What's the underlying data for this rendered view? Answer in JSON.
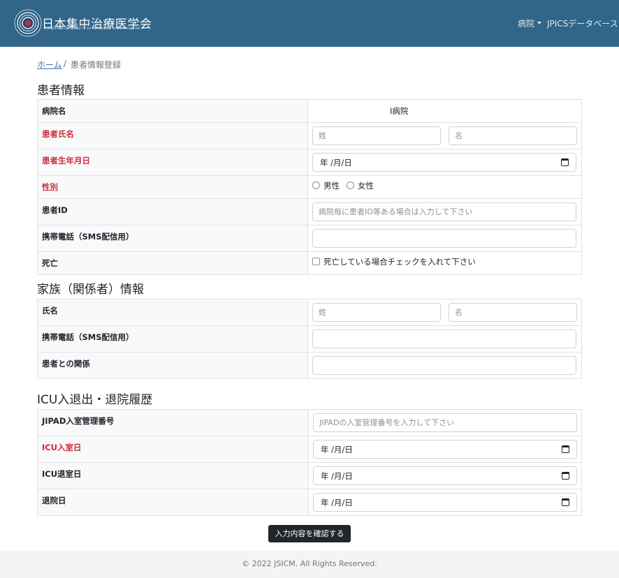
{
  "header": {
    "brand_jp": "日本集中治療医学会",
    "brand_en": "THE JAPANESE SOCIETY OF INTENSIVE CARE MEDICINE",
    "nav_hospital": "病院",
    "nav_db": "JPICSデータベース",
    "brand_color": "#31658a"
  },
  "breadcrumb": {
    "home": "ホーム",
    "separator": "/",
    "current": "患者情報登録"
  },
  "patient": {
    "title": "患者情報",
    "hospital_label": "病院名",
    "hospital_value": "I病院",
    "name_label": "患者氏名",
    "name_last_placeholder": "姓",
    "name_first_placeholder": "名",
    "dob_label": "患者生年月日",
    "dob_value": "年 /月/日",
    "sex_label": "性別",
    "sex_male": "男性",
    "sex_female": "女性",
    "id_label": "患者ID",
    "id_placeholder": "病院毎に患者ID等ある場合は入力して下さい",
    "phone_label": "携帯電話（SMS配信用）",
    "death_label": "死亡",
    "death_check_label": "死亡している場合チェックを入れて下さい"
  },
  "family": {
    "title": "家族（関係者）情報",
    "name_label": "氏名",
    "name_last_placeholder": "姓",
    "name_first_placeholder": "名",
    "phone_label": "携帯電話（SMS配信用）",
    "relation_label": "患者との関係"
  },
  "icu": {
    "title": "ICU入退出・退院履歴",
    "jipad_label": "JIPAD入室管理番号",
    "jipad_placeholder": "JIPADの入室管理番号を入力して下さい",
    "admit_label": "ICU入室日",
    "admit_value": "年 /月/日",
    "discharge_label": "ICU退室日",
    "discharge_value": "年 /月/日",
    "hospital_discharge_label": "退院日",
    "hospital_discharge_value": "年 /月/日"
  },
  "submit_label": "入力内容を確認する",
  "footer": "© 2022 JSICM. All Rights Reserved.",
  "required_color": "#d2283a"
}
